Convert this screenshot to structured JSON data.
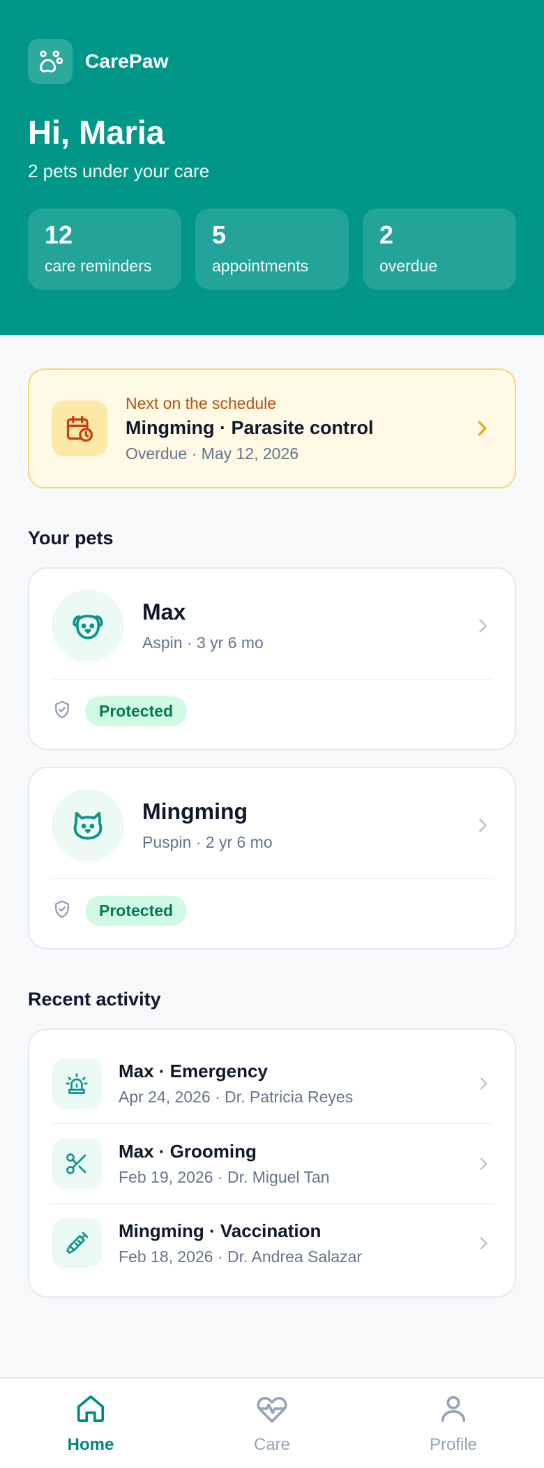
{
  "brand": {
    "name": "CarePaw"
  },
  "greeting": {
    "title": "Hi, Maria",
    "subtitle": "2 pets under your care"
  },
  "stats": [
    {
      "value": "12",
      "label": "care reminders"
    },
    {
      "value": "5",
      "label": "appointments"
    },
    {
      "value": "2",
      "label": "overdue"
    }
  ],
  "next": {
    "eyebrow": "Next on the schedule",
    "title": "Mingming · Parasite control",
    "subtitle": "Overdue · May 12, 2026"
  },
  "pets_section": {
    "title": "Your pets"
  },
  "pets": [
    {
      "name": "Max",
      "details": "Aspin · 3 yr 6 mo",
      "status": "Protected",
      "icon": "dog-icon"
    },
    {
      "name": "Mingming",
      "details": "Puspin · 2 yr 6 mo",
      "status": "Protected",
      "icon": "cat-icon"
    }
  ],
  "activity_section": {
    "title": "Recent activity"
  },
  "activity": [
    {
      "title": "Max · Emergency",
      "subtitle": "Apr 24, 2026 · Dr. Patricia Reyes",
      "icon": "siren-icon"
    },
    {
      "title": "Max · Grooming",
      "subtitle": "Feb 19, 2026 · Dr. Miguel Tan",
      "icon": "scissors-icon"
    },
    {
      "title": "Mingming · Vaccination",
      "subtitle": "Feb 18, 2026 · Dr. Andrea Salazar",
      "icon": "syringe-icon"
    }
  ],
  "nav": [
    {
      "label": "Home",
      "icon": "home-icon",
      "active": true
    },
    {
      "label": "Care",
      "icon": "heart-pulse-icon",
      "active": false
    },
    {
      "label": "Profile",
      "icon": "user-icon",
      "active": false
    }
  ],
  "colors": {
    "brand": "#009688",
    "accent": "#00897b",
    "warning_bg": "#fff9e6",
    "warning_text": "#b45309",
    "success_bg": "#d1fae5",
    "success_text": "#047857"
  }
}
